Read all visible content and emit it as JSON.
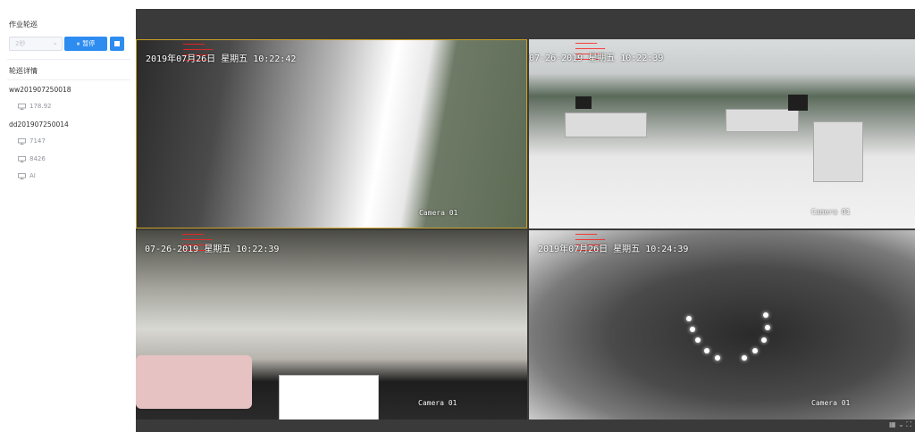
{
  "sidebar": {
    "job_title": "作业轮巡",
    "select_value": "2秒",
    "pause_label": "暂停",
    "detail_title": "轮巡详情",
    "groups": [
      {
        "name": "ww201907250018",
        "devices": [
          "178.92"
        ]
      },
      {
        "name": "dd201907250014",
        "devices": [
          "7147",
          "8426",
          "AI"
        ]
      }
    ]
  },
  "videos": [
    {
      "timestamp": "2019年07月26日 星期五 10:22:42",
      "camera": "Camera 01"
    },
    {
      "timestamp": "07-26-2019 星期五 10:22:39",
      "camera": "Camera 01"
    },
    {
      "timestamp": "07-26-2019 星期五 10:22:39",
      "camera": "Camera 01"
    },
    {
      "timestamp": "2019年07月26日 星期五 10:24:39",
      "camera": "Camera 01"
    }
  ],
  "icons": {
    "pause": "pause-icon",
    "stop": "stop-icon",
    "device": "monitor-icon",
    "chevron": "chevron-down-icon"
  },
  "colors": {
    "primary": "#2d8cf0",
    "active_border": "#c9a227",
    "osd_red": "#ff2020",
    "panel_bg": "#3a3a3a"
  }
}
